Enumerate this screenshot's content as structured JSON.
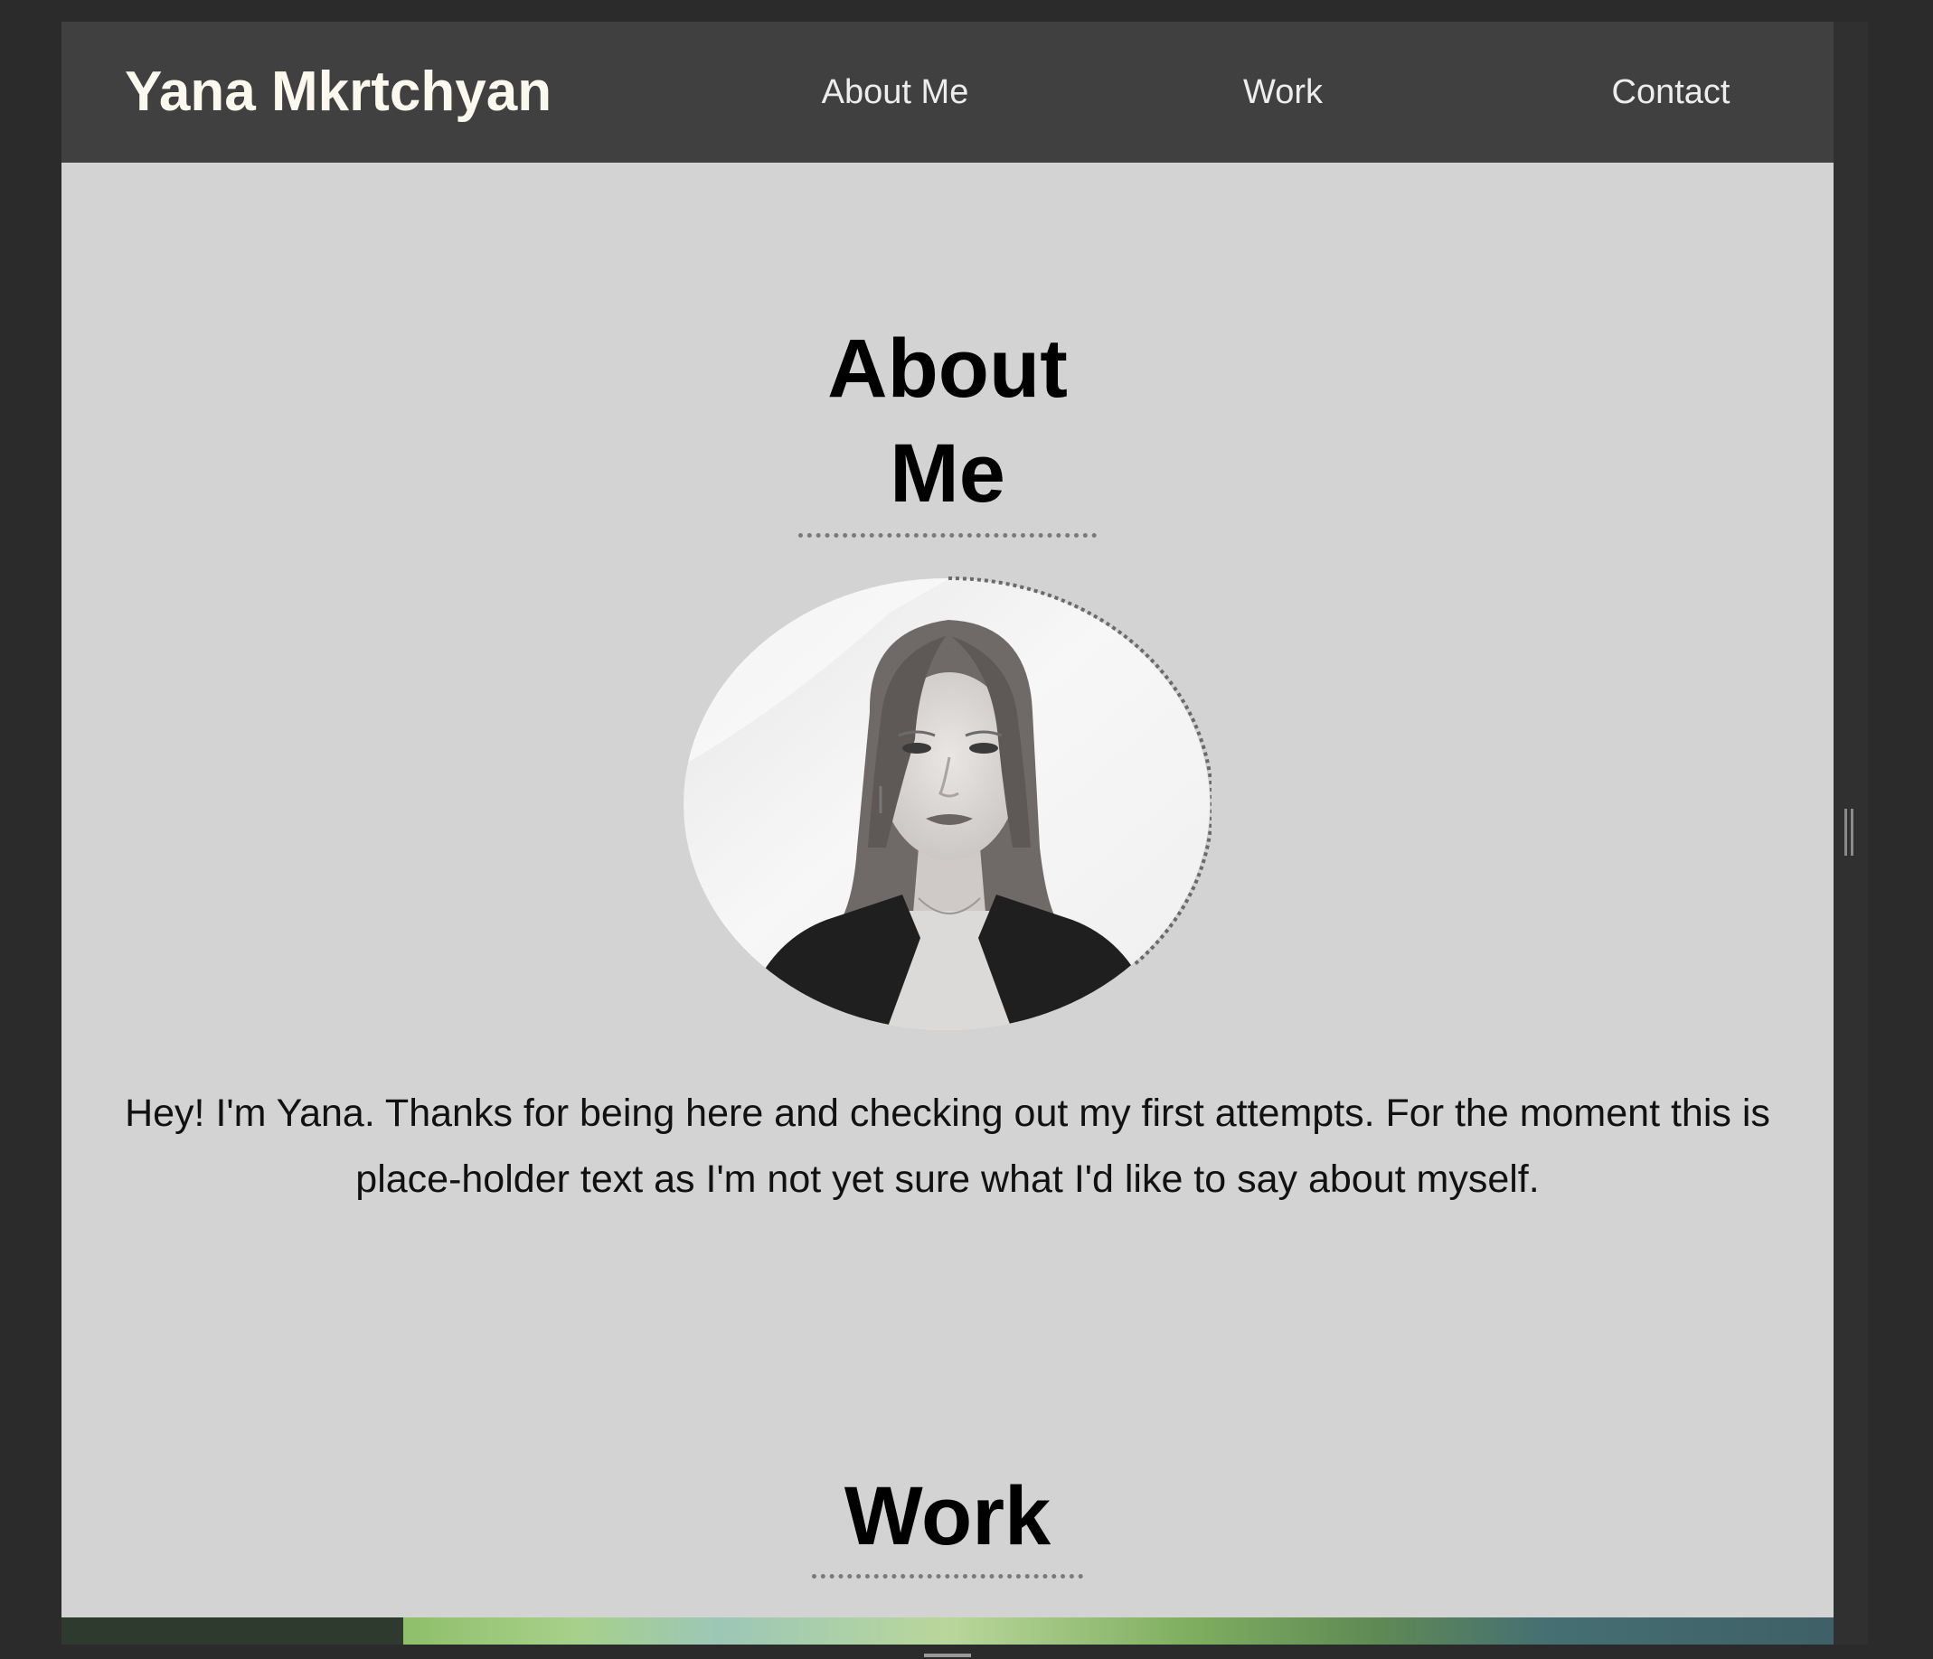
{
  "header": {
    "brand": "Yana Mkrtchyan",
    "nav": {
      "about": "About Me",
      "work": "Work",
      "contact": "Contact"
    }
  },
  "about": {
    "title_line1": "About",
    "title_line2": "Me",
    "portrait_icon": "portrait-photo",
    "bio": "Hey! I'm Yana. Thanks for being here and checking out my first attempts. For the moment this is place-holder text as I'm not yet sure what I'd like to say about myself."
  },
  "work": {
    "title": "Work"
  },
  "colors": {
    "page_background": "#d3d3d3",
    "header_background": "#404040",
    "brand_text": "#fbf8ee",
    "nav_text": "#ededed",
    "outer_background": "#2b2b2b"
  }
}
